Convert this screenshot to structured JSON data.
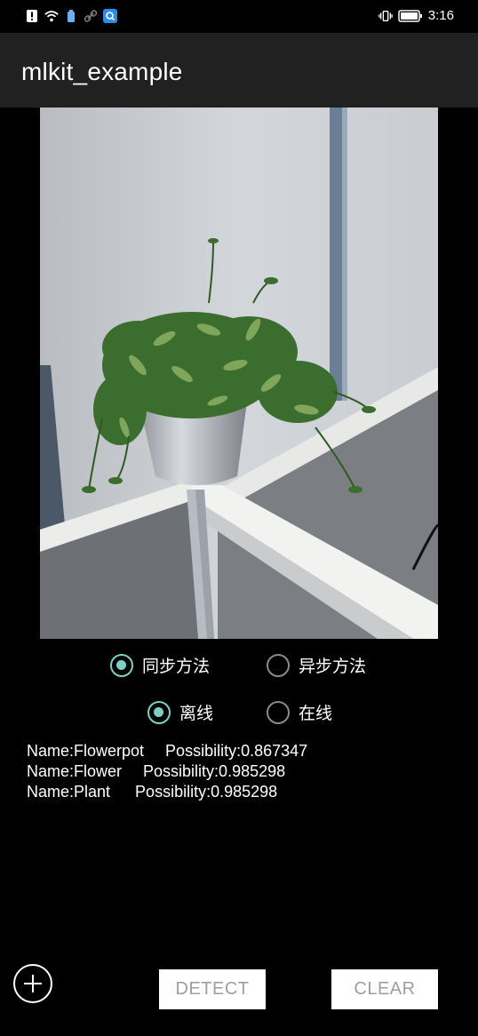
{
  "status_bar": {
    "time": "3:16",
    "left_icons": [
      "alert-icon",
      "wifi-icon",
      "battery-saver-icon",
      "link-icon",
      "search-app-icon"
    ],
    "right_icons": [
      "vibrate-icon",
      "battery-icon"
    ]
  },
  "app_bar": {
    "title": "mlkit_example"
  },
  "photo": {
    "description_icon": "plant-photo"
  },
  "method_options": {
    "sync_label": "同步方法",
    "async_label": "异步方法",
    "selected": "sync"
  },
  "mode_options": {
    "offline_label": "离线",
    "online_label": "在线",
    "selected": "offline"
  },
  "results": [
    {
      "name": "Name:Flowerpot",
      "possibility": "Possibility:0.867347"
    },
    {
      "name": "Name:Flower",
      "possibility": "Possibility:0.985298"
    },
    {
      "name": "Name:Plant",
      "possibility": "Possibility:0.985298"
    }
  ],
  "buttons": {
    "detect_label": "DETECT",
    "clear_label": "CLEAR"
  },
  "colors": {
    "accent": "#7fd0c4",
    "app_bar": "#212121"
  }
}
